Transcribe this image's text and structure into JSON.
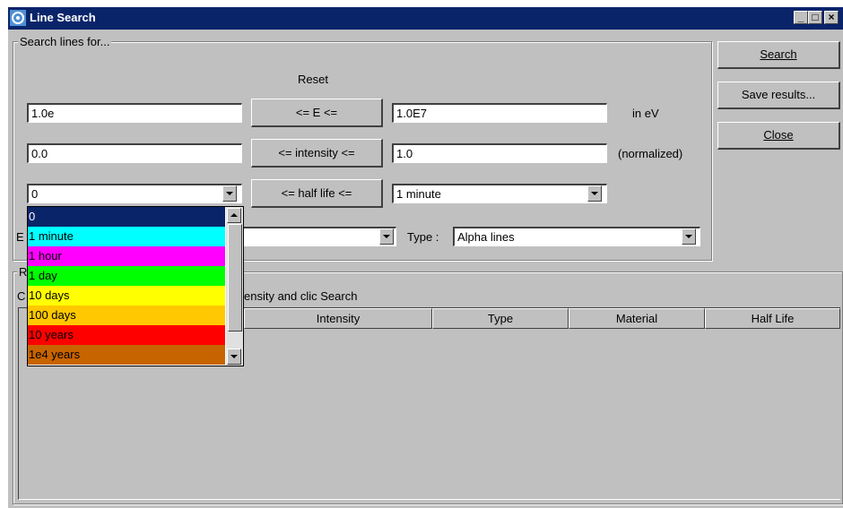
{
  "window": {
    "title": "Line Search",
    "minimize": "_",
    "maximize": "□",
    "close": "×"
  },
  "search_group": {
    "legend": "Search lines for...",
    "reset_label": "Reset",
    "energy": {
      "min": "1.0e",
      "button": "<= E <=",
      "max": "1.0E7",
      "unit": "in eV"
    },
    "intensity": {
      "min": "0.0",
      "button": "<= intensity <=",
      "max": "1.0",
      "unit": "(normalized)"
    },
    "half_life": {
      "min": "0",
      "button": "<= half life <=",
      "max": "1 minute"
    },
    "element": {
      "label_partial": "E",
      "value": ""
    },
    "type": {
      "label": "Type :",
      "value": "Alpha lines"
    }
  },
  "actions": {
    "search": "Search",
    "save": "Save results...",
    "close": "Close"
  },
  "results_group": {
    "legend_partial": "R",
    "hint_prefix": "C",
    "hint_visible": "ensity and clic Search",
    "columns": [
      "Intensity",
      "Type",
      "Material",
      "Half Life"
    ]
  },
  "dropdown": {
    "items": [
      {
        "label": "0",
        "bg": "#0a246a",
        "fg": "#ffffff"
      },
      {
        "label": "1 minute",
        "bg": "#00ffff",
        "fg": "#000000"
      },
      {
        "label": "1 hour",
        "bg": "#ff00ff",
        "fg": "#000000"
      },
      {
        "label": "1 day",
        "bg": "#00ff00",
        "fg": "#000000"
      },
      {
        "label": "10 days",
        "bg": "#ffff00",
        "fg": "#000000"
      },
      {
        "label": "100 days",
        "bg": "#ffc800",
        "fg": "#000000"
      },
      {
        "label": "10 years",
        "bg": "#ff0000",
        "fg": "#000000"
      },
      {
        "label": "1e4 years",
        "bg": "#c86400",
        "fg": "#000000"
      }
    ]
  }
}
